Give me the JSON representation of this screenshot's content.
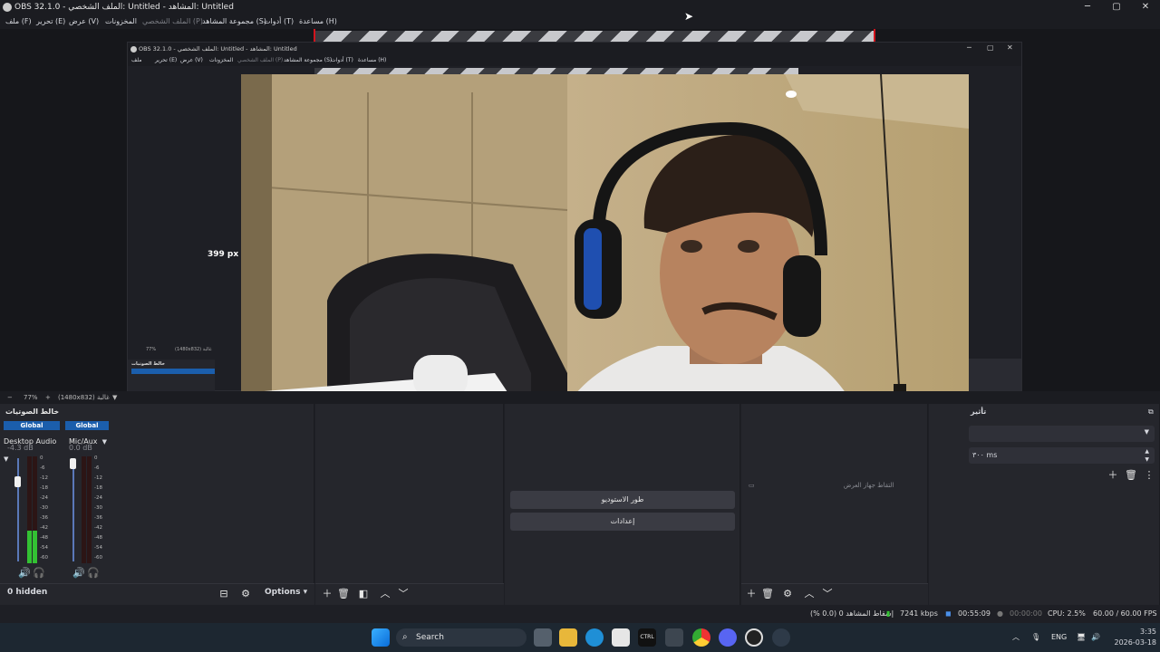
{
  "app": {
    "title": "OBS 32.1.0 - الملف الشخصي: Untitled - المشاهد: Untitled",
    "controls": {
      "minimize": "─",
      "maximize": "▢",
      "close": "✕"
    }
  },
  "menu": {
    "file": "ملف (F)",
    "edit": "تحرير (E)",
    "view": "عرض (V)",
    "docks": "المخزونات",
    "profile": "الملف الشخصي (P)",
    "scene_collection": "مجموعة المشاهد (S)",
    "tools": "أدوات (T)",
    "help": "مساعدة (H)"
  },
  "nested_preview": {
    "title": "OBS 32.1.0 - الملف الشخصي: Untitled - المشاهد: Untitled",
    "menu": [
      "ملف",
      "تحرير (E)",
      "عرض (V)",
      "المخزونات",
      "الملف الشخصي (P)",
      "مجموعة المشاهد (S)",
      "أدوات (T)",
      "مساعدة (H)"
    ],
    "mixer_title": "خالط الصوتيات",
    "zoom": "77%",
    "resolution": "(1480x832) غالبة"
  },
  "preview": {
    "distance_label": "399 px"
  },
  "preview_status": {
    "zoom": "77%",
    "resolution": "(1480x832) غالبة"
  },
  "mixer": {
    "title": "خالط الصوتيات",
    "channels": [
      {
        "global": "Global",
        "name": "Desktop Audio",
        "db": "-4.3 dB",
        "level": 0.25
      },
      {
        "global": "Global",
        "name": "Mic/Aux",
        "db": "0.0 dB",
        "level": 0.0
      }
    ],
    "scale": [
      "0",
      "-6",
      "-12",
      "-18",
      "-24",
      "-30",
      "-36",
      "-42",
      "-48",
      "-54",
      "-60"
    ],
    "hidden": "0 hidden",
    "options_label": "Options"
  },
  "controls": {
    "studio_mode": "طور الاستوديو",
    "settings": "إعدادات"
  },
  "sources": {
    "item_label": "التقاط جهاز العرض"
  },
  "transitions": {
    "title": "تأثير",
    "duration": "٣٠٠ ms"
  },
  "status": {
    "dropped": "إسقاط المشاهد 0 (0.0 %)",
    "bitrate": "7241 kbps",
    "stream_time": "00:55:09",
    "record_time": "00:00:00",
    "cpu": "CPU: 2.5%",
    "fps": "60.00 / 60.00 FPS"
  },
  "taskbar": {
    "search": "Search",
    "lang": "ENG",
    "time": "3:35",
    "date": "2026-03-18"
  },
  "colors": {
    "accent_blue": "#1b5eac",
    "meter_green": "#33c133",
    "snap_red": "#d2141d"
  }
}
